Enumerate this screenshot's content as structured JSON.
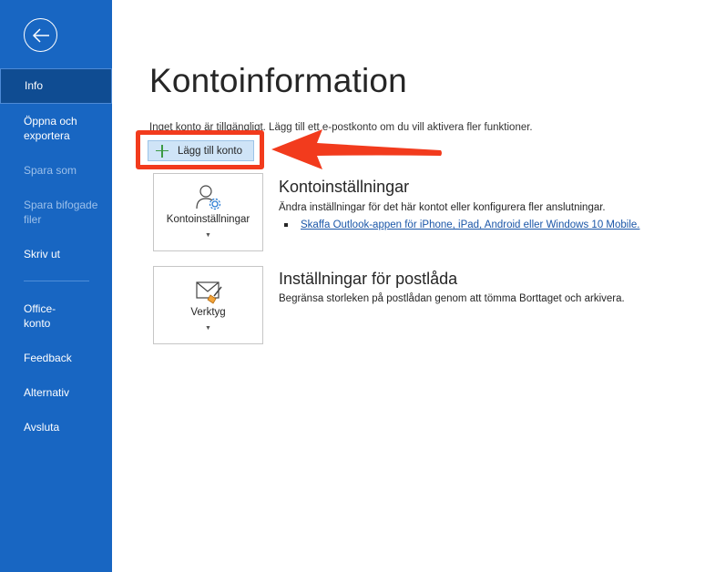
{
  "sidebar": {
    "items": [
      {
        "label": "Info"
      },
      {
        "label": "Öppna och exportera"
      },
      {
        "label": "Spara som"
      },
      {
        "label": "Spara bifogade filer"
      },
      {
        "label": "Skriv ut"
      },
      {
        "label": "Office-konto"
      },
      {
        "label": "Feedback"
      },
      {
        "label": "Alternativ"
      },
      {
        "label": "Avsluta"
      }
    ]
  },
  "main": {
    "title": "Kontoinformation",
    "info_text": "Inget konto är tillgängligt. Lägg till ett e-postkonto om du vill aktivera fler funktioner.",
    "add_account_label": "Lägg till konto",
    "sections": [
      {
        "tile_label": "Kontoinställningar",
        "title": "Kontoinställningar",
        "description": "Ändra inställningar för det här kontot eller konfigurera fler anslutningar.",
        "link": "Skaffa Outlook-appen för iPhone, iPad, Android eller Windows 10 Mobile."
      },
      {
        "tile_label": "Verktyg",
        "title": "Inställningar för postlåda",
        "description": "Begränsa storleken på postlådan genom att tömma Borttaget och arkivera."
      }
    ]
  },
  "colors": {
    "sidebar": "#1866c2",
    "sidebar_active": "#0f4c92",
    "highlight": "#f23b1d",
    "add_button": "#cfe4f7",
    "link": "#1a56a8"
  },
  "icons": {
    "back": "back-arrow-icon",
    "add": "plus-icon",
    "account_settings": "user-gear-icon",
    "tools": "mailbox-broom-icon",
    "annotation": "red-arrow-icon"
  }
}
